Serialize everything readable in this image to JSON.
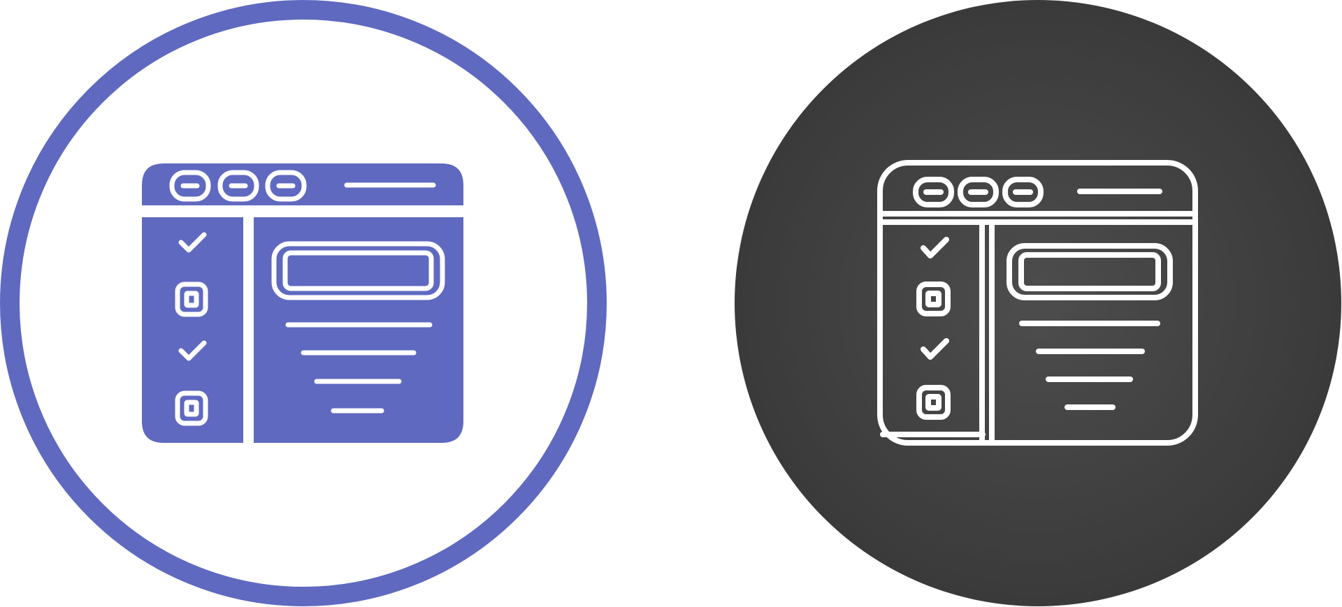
{
  "icons": [
    {
      "name": "checklist-browser-glyph-icon",
      "style": "glyph",
      "ring_color": "#5f69c0",
      "fill_color": "#5f69c0",
      "background_color": "#ffffff",
      "line_color": "#ffffff",
      "checklist": [
        "checked",
        "unchecked",
        "checked",
        "unchecked"
      ]
    },
    {
      "name": "checklist-browser-outline-icon",
      "style": "outline",
      "circle_color_center": "#4d4d4d",
      "circle_color_edge": "#3a3a3a",
      "line_color": "#ffffff",
      "checklist": [
        "checked",
        "unchecked",
        "checked",
        "unchecked"
      ]
    }
  ]
}
